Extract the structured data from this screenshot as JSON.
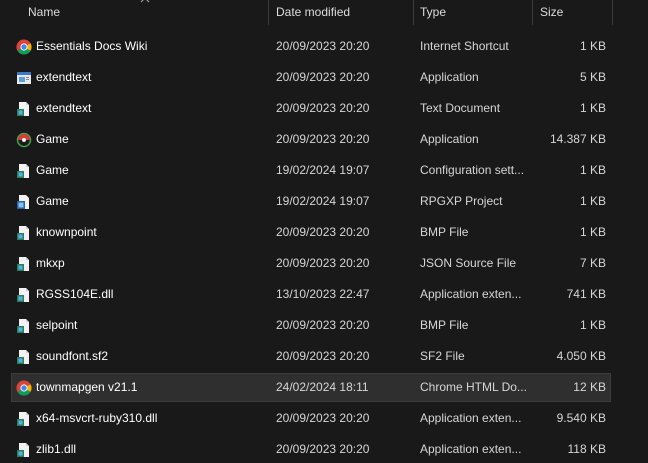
{
  "columns": {
    "name": "Name",
    "date_modified": "Date modified",
    "type": "Type",
    "size": "Size"
  },
  "colors": {
    "background": "#191919",
    "selected_row": "#2f2f2f",
    "text": "#ffffff",
    "secondary_text": "#d6d6d6"
  },
  "files": [
    {
      "name": "Essentials Docs Wiki",
      "date": "20/09/2023 20:20",
      "type": "Internet Shortcut",
      "size": "1 KB",
      "icon": "chrome-icon",
      "selected": false
    },
    {
      "name": "extendtext",
      "date": "20/09/2023 20:20",
      "type": "Application",
      "size": "5 KB",
      "icon": "application-icon",
      "selected": false
    },
    {
      "name": "extendtext",
      "date": "20/09/2023 20:20",
      "type": "Text Document",
      "size": "1 KB",
      "icon": "document-icon",
      "selected": false
    },
    {
      "name": "Game",
      "date": "20/09/2023 20:20",
      "type": "Application",
      "size": "14.387 KB",
      "icon": "game-app-icon",
      "selected": false
    },
    {
      "name": "Game",
      "date": "19/02/2024 19:07",
      "type": "Configuration sett...",
      "size": "1 KB",
      "icon": "document-icon",
      "selected": false
    },
    {
      "name": "Game",
      "date": "19/02/2024 19:07",
      "type": "RPGXP Project",
      "size": "1 KB",
      "icon": "rpgxp-project-icon",
      "selected": false
    },
    {
      "name": "knownpoint",
      "date": "20/09/2023 20:20",
      "type": "BMP File",
      "size": "1 KB",
      "icon": "document-icon",
      "selected": false
    },
    {
      "name": "mkxp",
      "date": "20/09/2023 20:20",
      "type": "JSON Source File",
      "size": "7 KB",
      "icon": "document-icon",
      "selected": false
    },
    {
      "name": "RGSS104E.dll",
      "date": "13/10/2023 22:47",
      "type": "Application exten...",
      "size": "741 KB",
      "icon": "document-icon",
      "selected": false
    },
    {
      "name": "selpoint",
      "date": "20/09/2023 20:20",
      "type": "BMP File",
      "size": "1 KB",
      "icon": "document-icon",
      "selected": false
    },
    {
      "name": "soundfont.sf2",
      "date": "20/09/2023 20:20",
      "type": "SF2 File",
      "size": "4.050 KB",
      "icon": "document-icon",
      "selected": false
    },
    {
      "name": "townmapgen v21.1",
      "date": "24/02/2024 18:11",
      "type": "Chrome HTML Do...",
      "size": "12 KB",
      "icon": "chrome-icon",
      "selected": true
    },
    {
      "name": "x64-msvcrt-ruby310.dll",
      "date": "20/09/2023 20:20",
      "type": "Application exten...",
      "size": "9.540 KB",
      "icon": "document-icon",
      "selected": false
    },
    {
      "name": "zlib1.dll",
      "date": "20/09/2023 20:20",
      "type": "Application exten...",
      "size": "118 KB",
      "icon": "document-icon",
      "selected": false
    }
  ]
}
